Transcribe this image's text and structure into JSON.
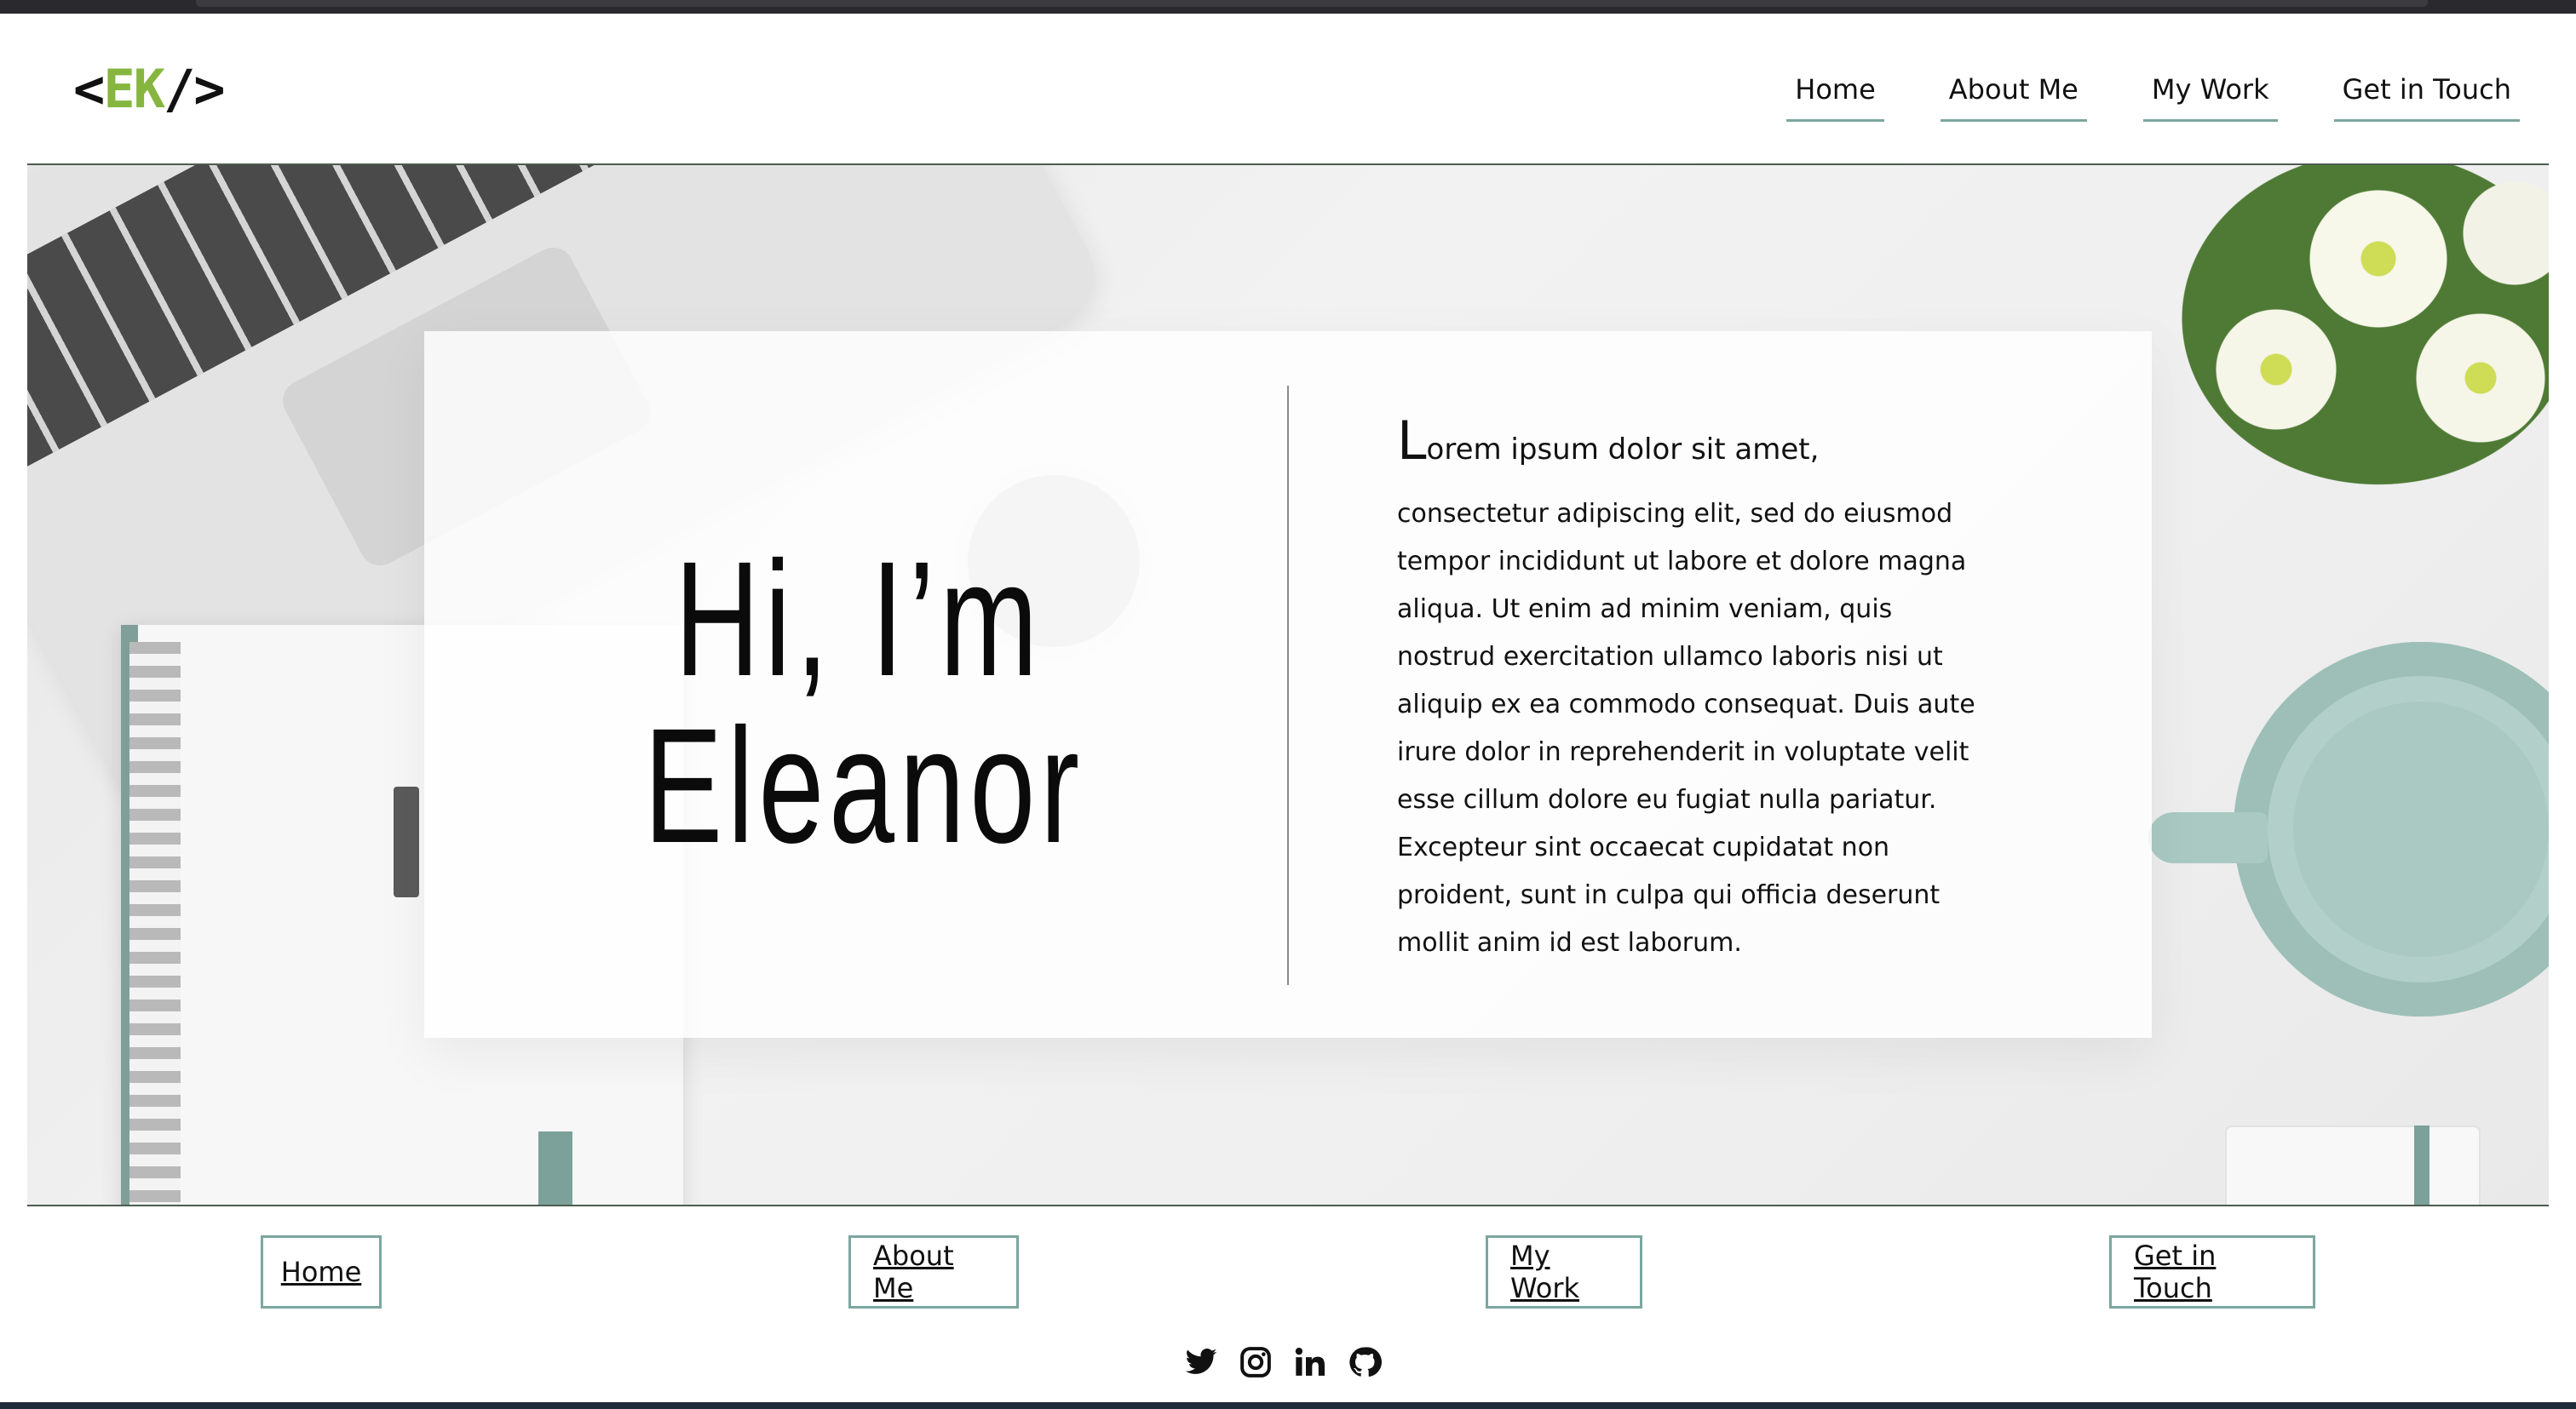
{
  "logo": {
    "left_bracket": "<",
    "initials": "EK",
    "right_bracket": "/>",
    "accent_color": "#86b640"
  },
  "header_nav": [
    {
      "label": "Home"
    },
    {
      "label": "About Me"
    },
    {
      "label": "My Work"
    },
    {
      "label": "Get in Touch"
    }
  ],
  "hero": {
    "title_line1": "Hi, I’m",
    "title_line2": "Eleanor",
    "lead_cap": "L",
    "lead_rest": "orem ipsum dolor sit amet,",
    "body": "consectetur adipiscing elit, sed do eiusmod tempor incididunt ut labore et dolore magna aliqua. Ut enim ad minim veniam, quis nostrud exercitation ullamco laboris nisi ut aliquip ex ea commodo consequat. Duis aute irure dolor in reprehenderit in voluptate velit esse cillum dolore eu fugiat nulla pariatur. Excepteur sint occaecat cupidatat non proident, sunt in culpa qui officia deserunt mollit anim id est laborum."
  },
  "footer_nav": [
    {
      "label": "Home"
    },
    {
      "label": "About Me"
    },
    {
      "label": "My Work"
    },
    {
      "label": "Get in Touch"
    }
  ],
  "social_icons": [
    "twitter-icon",
    "instagram-icon",
    "linkedin-icon",
    "github-icon"
  ],
  "colors": {
    "accent_teal": "#7ba7a0",
    "logo_green": "#86b640",
    "text": "#111111"
  }
}
